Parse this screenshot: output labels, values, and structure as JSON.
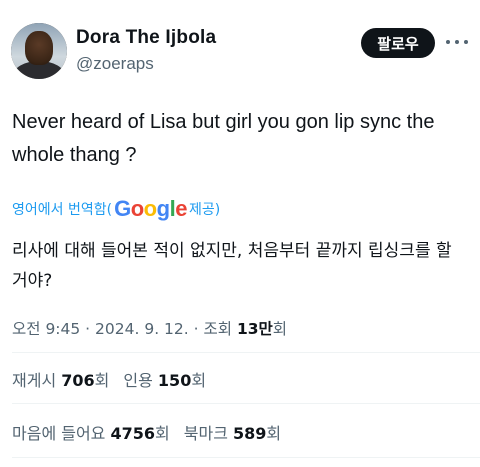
{
  "author": {
    "name": "Dora The Ijbola",
    "handle": "@zoeraps"
  },
  "follow_button": "팔로우",
  "tweet": {
    "text": "Never heard of Lisa but girl you gon lip sync the whole thang ?"
  },
  "translation": {
    "prefix": "영어에서 번역함(",
    "provider": "Google",
    "suffix": " 제공)",
    "text": "리사에 대해 들어본 적이 없지만, 처음부터 끝까지 립싱크를 할 거야?"
  },
  "meta": {
    "time_date": "오전 9:45 · 2024. 9. 12. · 조회 ",
    "views_number": "13만",
    "views_suffix": "회"
  },
  "stats": {
    "reposts": {
      "label": "재게시 ",
      "value": "706",
      "suffix": "회"
    },
    "quotes": {
      "label": "인용 ",
      "value": "150",
      "suffix": "회"
    },
    "likes": {
      "label": "마음에 들어요 ",
      "value": "4756",
      "suffix": "회"
    },
    "bookmarks": {
      "label": "북마크 ",
      "value": "589",
      "suffix": "회"
    }
  },
  "colors": {
    "link_blue": "#1d9bf0",
    "muted_text": "#536471",
    "primary_text": "#0f1419"
  }
}
